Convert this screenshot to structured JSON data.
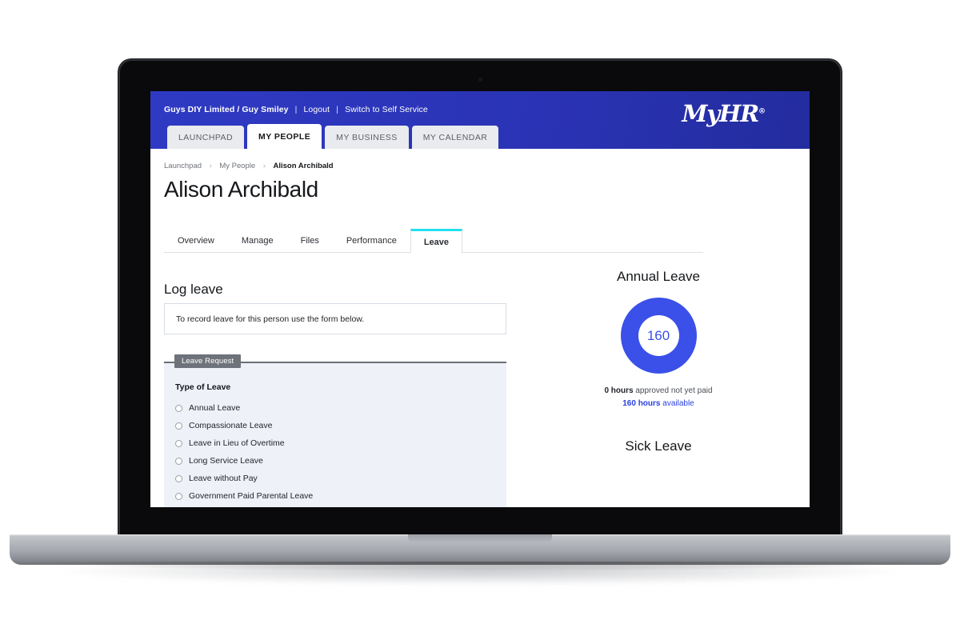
{
  "topbar": {
    "account": "Guys DIY Limited / Guy Smiley",
    "logout": "Logout",
    "switch": "Switch to Self Service",
    "separator": "|",
    "brand": "MyHR",
    "brand_mark": "®"
  },
  "nav_tabs": [
    {
      "label": "LAUNCHPAD",
      "active": false
    },
    {
      "label": "MY PEOPLE",
      "active": true
    },
    {
      "label": "MY BUSINESS",
      "active": false
    },
    {
      "label": "MY CALENDAR",
      "active": false
    }
  ],
  "breadcrumb": {
    "items": [
      "Launchpad",
      "My People",
      "Alison Archibald"
    ],
    "chevron": "›"
  },
  "page_title": "Alison Archibald",
  "sub_tabs": [
    {
      "label": "Overview",
      "active": false
    },
    {
      "label": "Manage",
      "active": false
    },
    {
      "label": "Files",
      "active": false
    },
    {
      "label": "Performance",
      "active": false
    },
    {
      "label": "Leave",
      "active": true
    }
  ],
  "log_leave": {
    "heading": "Log leave",
    "info_text": "To record leave for this person use the form below."
  },
  "leave_request_form": {
    "legend": "Leave Request",
    "field_label": "Type of Leave",
    "options": [
      "Annual Leave",
      "Compassionate Leave",
      "Leave in Lieu of Overtime",
      "Long Service Leave",
      "Leave without Pay",
      "Government Paid Parental Leave"
    ]
  },
  "balances": [
    {
      "title": "Annual Leave",
      "center_value": "160",
      "pending_amount": "0 hours",
      "pending_text": " approved not yet paid",
      "available_amount": "160 hours",
      "available_text": " available"
    },
    {
      "title": "Sick Leave"
    }
  ],
  "colors": {
    "header_blue": "#2b35bd",
    "accent_cyan": "#22e0f0",
    "donut_blue": "#3a50e8",
    "link_blue": "#2b40e0",
    "panel_bg": "#eef1f7"
  }
}
